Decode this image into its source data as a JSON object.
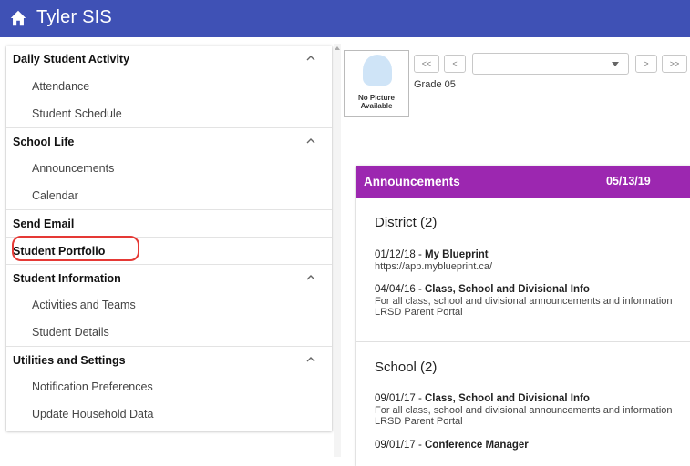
{
  "app": {
    "title": "Tyler SIS"
  },
  "sidebar": {
    "daily": {
      "label": "Daily Student Activity",
      "items": [
        "Attendance",
        "Student Schedule"
      ]
    },
    "school_life": {
      "label": "School Life",
      "items": [
        "Announcements",
        "Calendar"
      ]
    },
    "send_email": {
      "label": "Send Email"
    },
    "portfolio": {
      "label": "Student Portfolio"
    },
    "student_info": {
      "label": "Student Information",
      "items": [
        "Activities and Teams",
        "Student Details"
      ]
    },
    "utilities": {
      "label": "Utilities and Settings",
      "items": [
        "Notification Preferences",
        "Update Household Data"
      ]
    }
  },
  "student": {
    "photo_text": "No Picture Available",
    "grade": "Grade 05",
    "nav": {
      "first": "<<",
      "prev": "<",
      "next": ">",
      "last": ">>"
    },
    "selected": ""
  },
  "announcements": {
    "title": "Announcements",
    "date": "05/13/19",
    "district": {
      "title": "District (2)",
      "items": [
        {
          "date": "01/12/18",
          "title": "My Blueprint",
          "lines": [
            "https://app.myblueprint.ca/"
          ]
        },
        {
          "date": "04/04/16",
          "title": "Class, School and Divisional Info",
          "lines": [
            "For all class, school and divisional announcements and information",
            "LRSD Parent Portal"
          ]
        }
      ]
    },
    "school": {
      "title": "School (2)",
      "items": [
        {
          "date": "09/01/17",
          "title": "Class, School and Divisional Info",
          "lines": [
            "For all class, school and divisional announcements and information",
            "LRSD Parent Portal"
          ]
        },
        {
          "date": "09/01/17",
          "title": "Conference Manager",
          "lines": []
        }
      ]
    }
  },
  "colors": {
    "header": "#3f51b5",
    "announcement_header": "#9c27b0",
    "highlight": "#e53935"
  }
}
